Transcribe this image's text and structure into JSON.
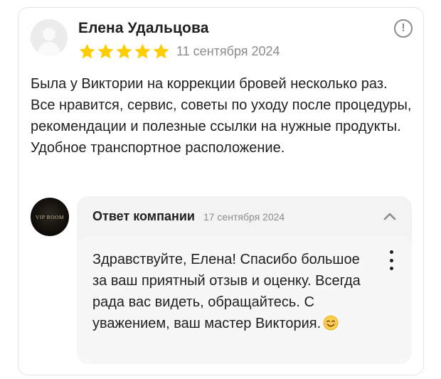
{
  "review": {
    "author": "Елена Удальцова",
    "rating": 5,
    "date": "11 сентября 2024",
    "text": "Была у Виктории на коррекции бровей несколько раз. Все нравится, сервис, советы по уходу после процедуры, рекомендации и полезные ссылки на нужные продукты. Удобное транспортное расположение.",
    "star_color": "#ffcc00"
  },
  "company": {
    "logo_text": "VIP ROOM"
  },
  "reply": {
    "title": "Ответ компании",
    "date": "17 сентября 2024",
    "text": "Здравствуйте, Елена! Спасибо большое за ваш приятный отзыв и оценку. Всегда рада вас видеть, обращайтесь. С уважением, ваш мастер Виктория.",
    "emoji": "smiling-face-icon"
  },
  "icons": {
    "report": "exclamation-circle-icon",
    "collapse": "chevron-up-icon",
    "menu": "vertical-dots-icon"
  }
}
